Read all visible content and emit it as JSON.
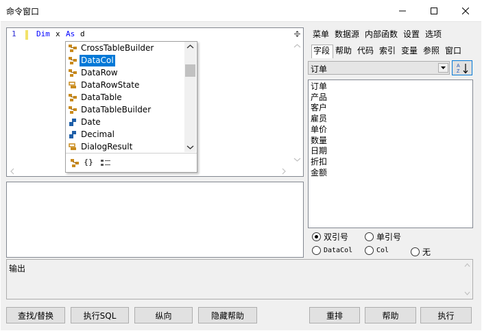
{
  "window": {
    "title": "命令窗口"
  },
  "editor": {
    "line_number": "1",
    "code_keyword1": "Dim",
    "code_var": "x",
    "code_keyword2": "As",
    "code_typed": "d"
  },
  "autocomplete": {
    "items": [
      {
        "label": "CrossTableBuilder",
        "icon": "class-icon"
      },
      {
        "label": "DataCol",
        "icon": "class-icon",
        "selected": true
      },
      {
        "label": "DataRow",
        "icon": "class-icon"
      },
      {
        "label": "DataRowState",
        "icon": "enum-icon"
      },
      {
        "label": "DataTable",
        "icon": "class-icon"
      },
      {
        "label": "DataTableBuilder",
        "icon": "class-icon"
      },
      {
        "label": "Date",
        "icon": "struct-icon"
      },
      {
        "label": "Decimal",
        "icon": "struct-icon"
      },
      {
        "label": "DialogResult",
        "icon": "enum-icon"
      }
    ],
    "footer_icons": [
      "class-filter-icon",
      "namespace-filter-icon",
      "member-filter-icon"
    ],
    "footer_brace_text": "{}"
  },
  "right_panel": {
    "tabs_row1": [
      "菜单",
      "数据源",
      "内部函数",
      "设置",
      "选项"
    ],
    "tabs_row2": [
      "字段",
      "帮助",
      "代码",
      "索引",
      "变量",
      "参照",
      "窗口"
    ],
    "selected_tab": "字段",
    "table_select": "订单",
    "fields": [
      "订单",
      "产品",
      "客户",
      "雇员",
      "单价",
      "数量",
      "日期",
      "折扣",
      "金额"
    ],
    "radio_row1": [
      {
        "label": "双引号",
        "checked": true
      },
      {
        "label": "单引号",
        "checked": false
      }
    ],
    "radio_row2": [
      {
        "label": "DataCol",
        "checked": false
      },
      {
        "label": "Col",
        "checked": false
      },
      {
        "label": "无",
        "checked": false
      }
    ]
  },
  "output": {
    "label": "输出"
  },
  "buttons": {
    "find_replace": "查找/替换",
    "exec_sql": "执行SQL",
    "vertical": "纵向",
    "hide_help": "隐藏帮助",
    "rearrange": "重排",
    "help": "帮助",
    "execute": "执行"
  },
  "colors": {
    "selection": "#0078d7",
    "keyword": "#0000ff",
    "line_number": "#2b2bd4",
    "current_line_marker": "#f2e26a",
    "window_bg": "#f0f0f0"
  }
}
